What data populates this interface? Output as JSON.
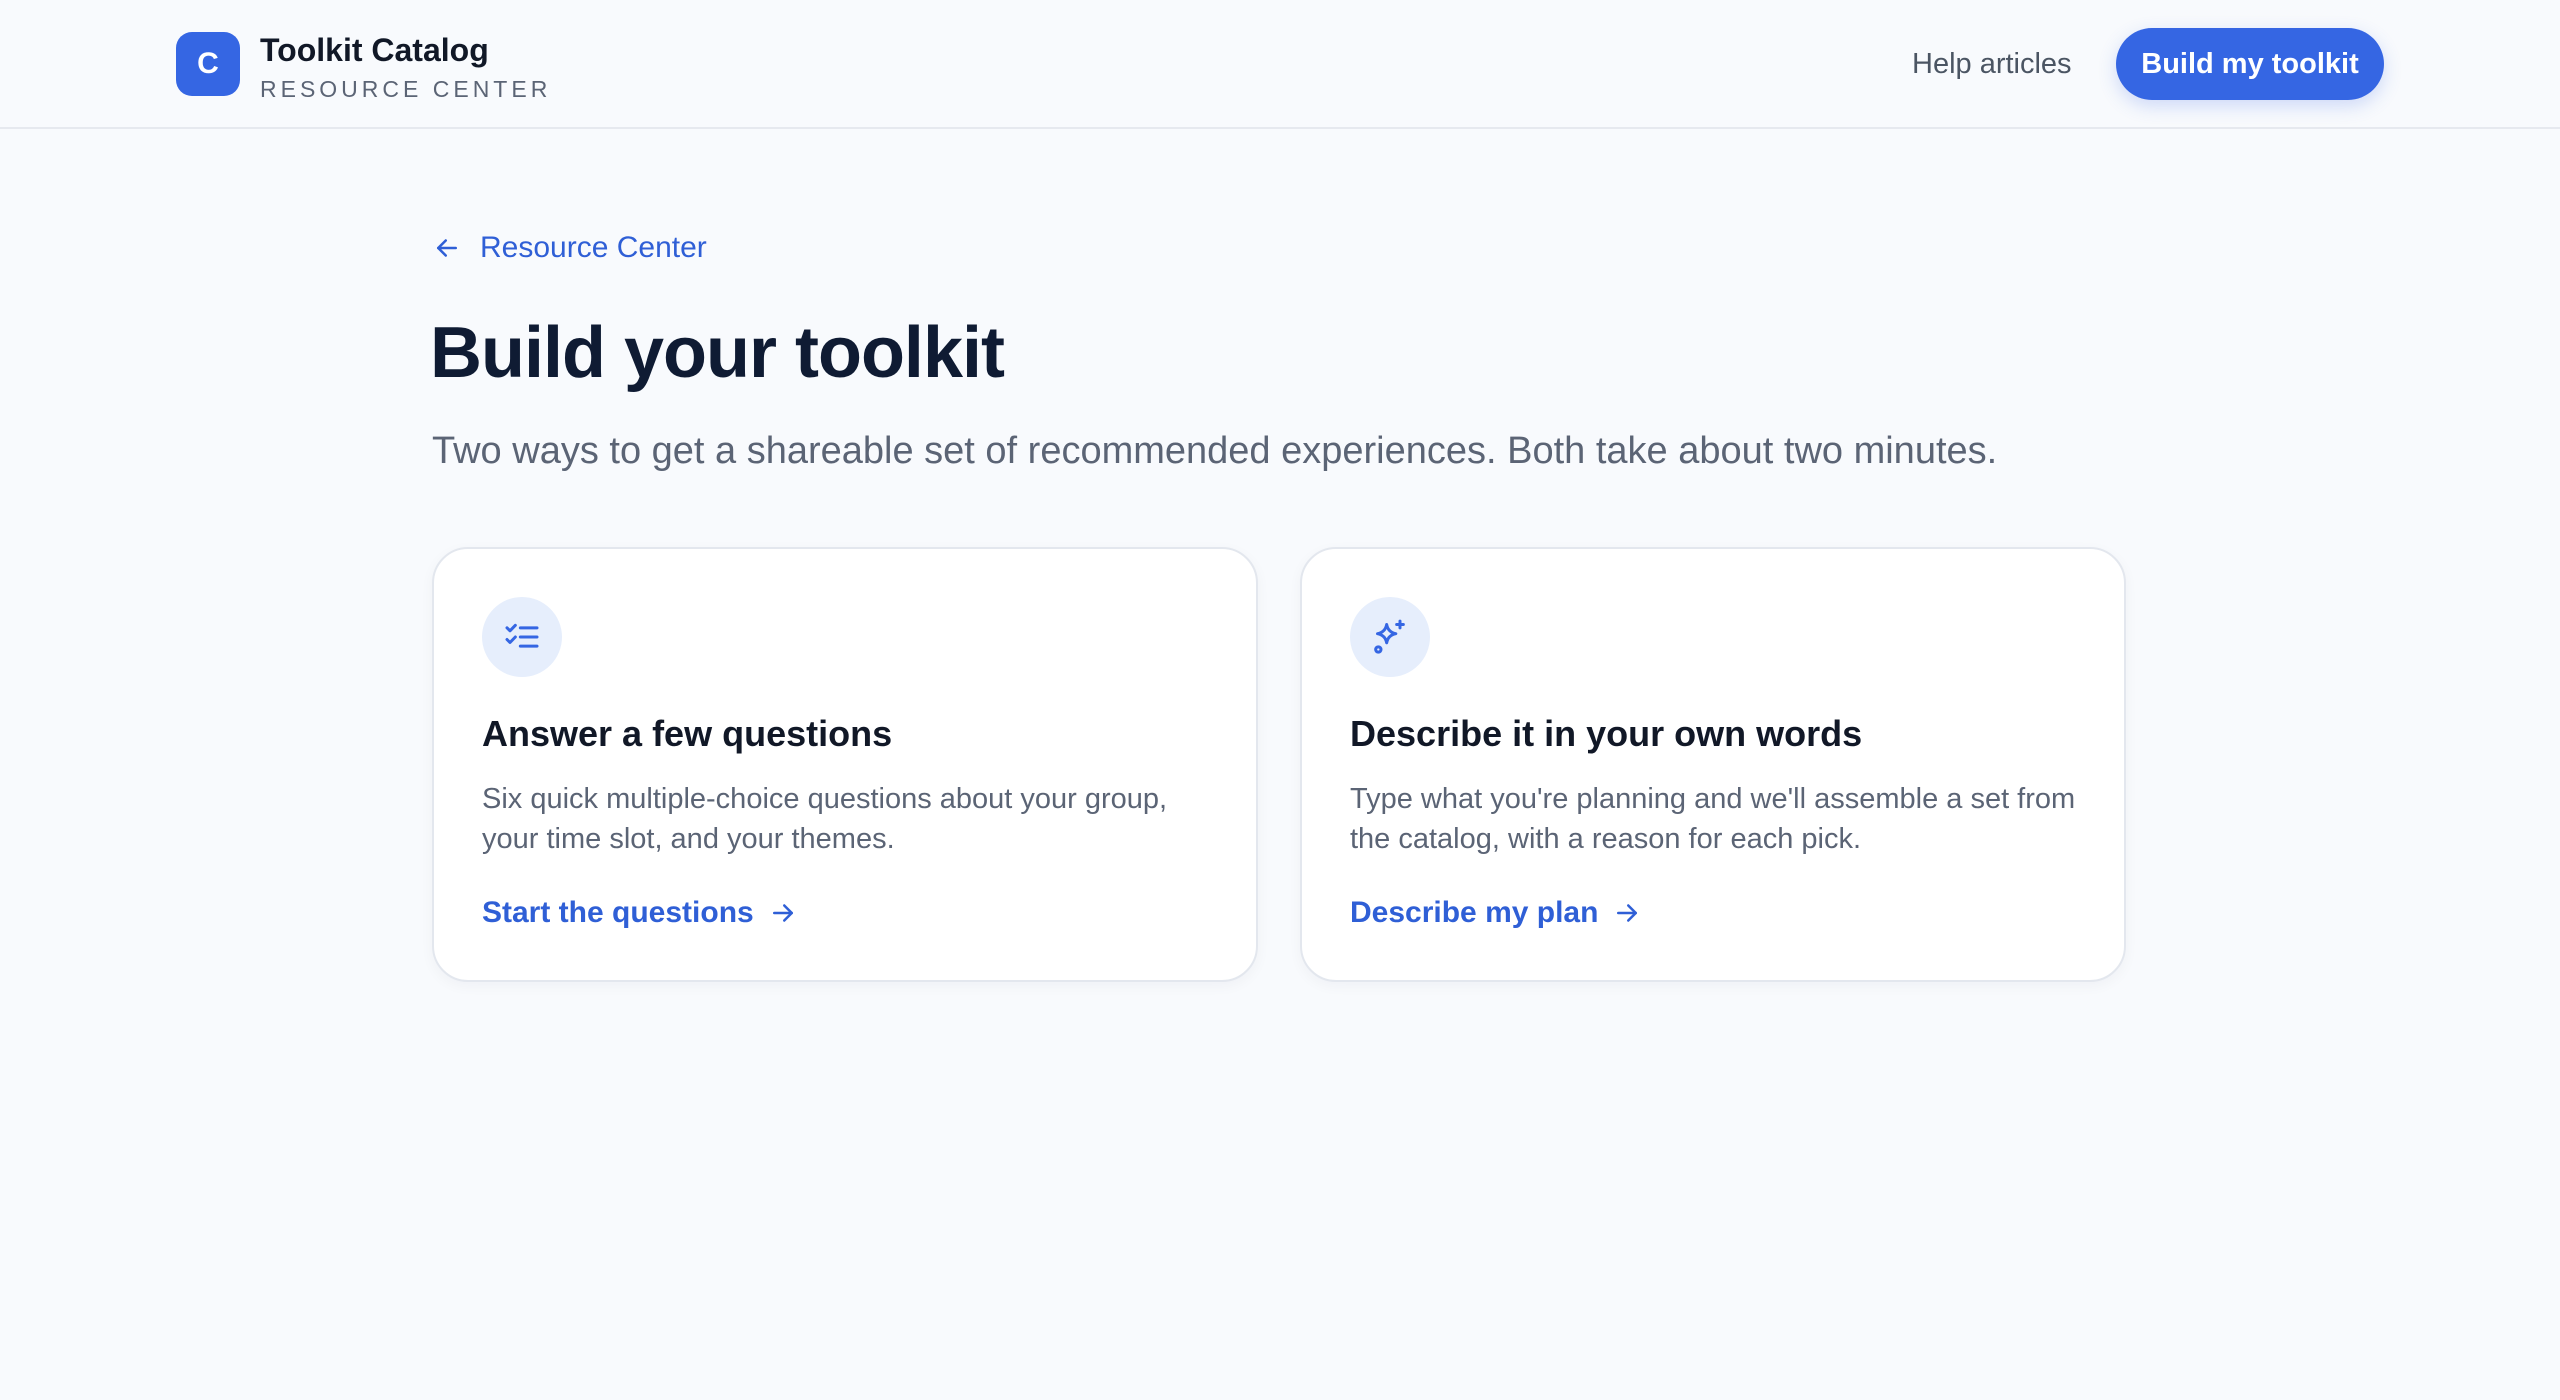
{
  "header": {
    "logo_letter": "C",
    "brand_title": "Toolkit Catalog",
    "brand_subtitle": "RESOURCE CENTER",
    "help_link": "Help articles",
    "cta_label": "Build my toolkit"
  },
  "breadcrumb": {
    "back_label": "Resource Center",
    "icon": "arrow-left-icon"
  },
  "page": {
    "title": "Build your toolkit",
    "subtitle": "Two ways to get a shareable set of recommended experiences. Both take about two minutes."
  },
  "cards": [
    {
      "icon": "checklist-icon",
      "title": "Answer a few questions",
      "description": "Six quick multiple-choice questions about your group, your time slot, and your themes.",
      "link_label": "Start the questions"
    },
    {
      "icon": "sparkles-icon",
      "title": "Describe it in your own words",
      "description": "Type what you're planning and we'll assemble a set from the catalog, with a reason for each pick.",
      "link_label": "Describe my plan"
    }
  ],
  "colors": {
    "accent": "#3566e3",
    "link": "#2f5fd6",
    "background": "#f8fafd",
    "icon_bg": "#e6eefc",
    "title": "#0f1b33",
    "muted_text": "#5b6475"
  }
}
